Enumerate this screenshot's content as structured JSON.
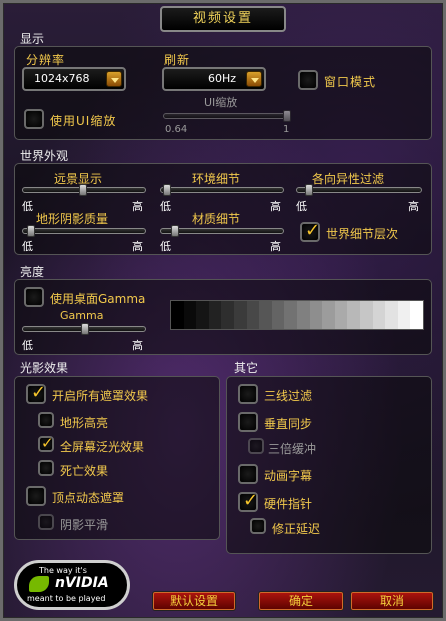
{
  "window": {
    "title": "视频设置"
  },
  "display": {
    "section_label": "显示",
    "resolution": {
      "label": "分辨率",
      "value": "1024x768"
    },
    "refresh": {
      "label": "刷新",
      "value": "60Hz"
    },
    "windowed_mode": {
      "label": "窗口模式",
      "checked": false
    },
    "use_ui_scale": {
      "label": "使用UI缩放",
      "checked": false
    },
    "ui_scale": {
      "label": "UI缩放",
      "min_label": "0.64",
      "max_label": "1"
    }
  },
  "world": {
    "section_label": "世界外观",
    "low": "低",
    "high": "高",
    "sliders": [
      {
        "key": "view_distance",
        "label": "远景显示"
      },
      {
        "key": "env_detail",
        "label": "环境细节"
      },
      {
        "key": "aniso",
        "label": "各向异性过滤"
      },
      {
        "key": "terrain_shadow",
        "label": "地形阴影质量"
      },
      {
        "key": "texture_detail",
        "label": "材质细节"
      }
    ],
    "world_detail_lod": {
      "label": "世界细节层次",
      "checked": true
    }
  },
  "brightness": {
    "section_label": "亮度",
    "use_desktop_gamma": {
      "label": "使用桌面Gamma",
      "checked": false
    },
    "gamma_label": "Gamma",
    "low": "低",
    "high": "高"
  },
  "effects": {
    "section_label": "光影效果",
    "all_shaders": {
      "label": "开启所有遮罩效果",
      "checked": true
    },
    "terrain_highlight": {
      "label": "地形高亮",
      "checked": false
    },
    "fullscreen_glow": {
      "label": "全屏幕泛光效果",
      "checked": true
    },
    "death_effect": {
      "label": "死亡效果",
      "checked": false
    },
    "vertex_shader": {
      "label": "顶点动态遮罩",
      "checked": false
    },
    "shadow_smooth": {
      "label": "阴影平滑",
      "checked": false
    }
  },
  "misc": {
    "section_label": "其它",
    "trilinear": {
      "label": "三线过滤",
      "checked": false
    },
    "vsync": {
      "label": "垂直同步",
      "checked": false
    },
    "triple_buffer": {
      "label": "三倍缓冲",
      "checked": false
    },
    "anim_subtitles": {
      "label": "动画字幕",
      "checked": false
    },
    "hardware_cursor": {
      "label": "硬件指针",
      "checked": true
    },
    "fix_lag": {
      "label": "修正延迟",
      "checked": false
    }
  },
  "footer": {
    "default_button": "默认设置",
    "ok_button": "确定",
    "cancel_button": "取消",
    "nvidia_line1": "The way it's",
    "nvidia_brand": "nVIDIA",
    "nvidia_line2": "meant to be played"
  },
  "colors": {
    "gold": "#f2c94c",
    "button_red": "#a3120c",
    "frame_grey": "#6b6b6b"
  }
}
